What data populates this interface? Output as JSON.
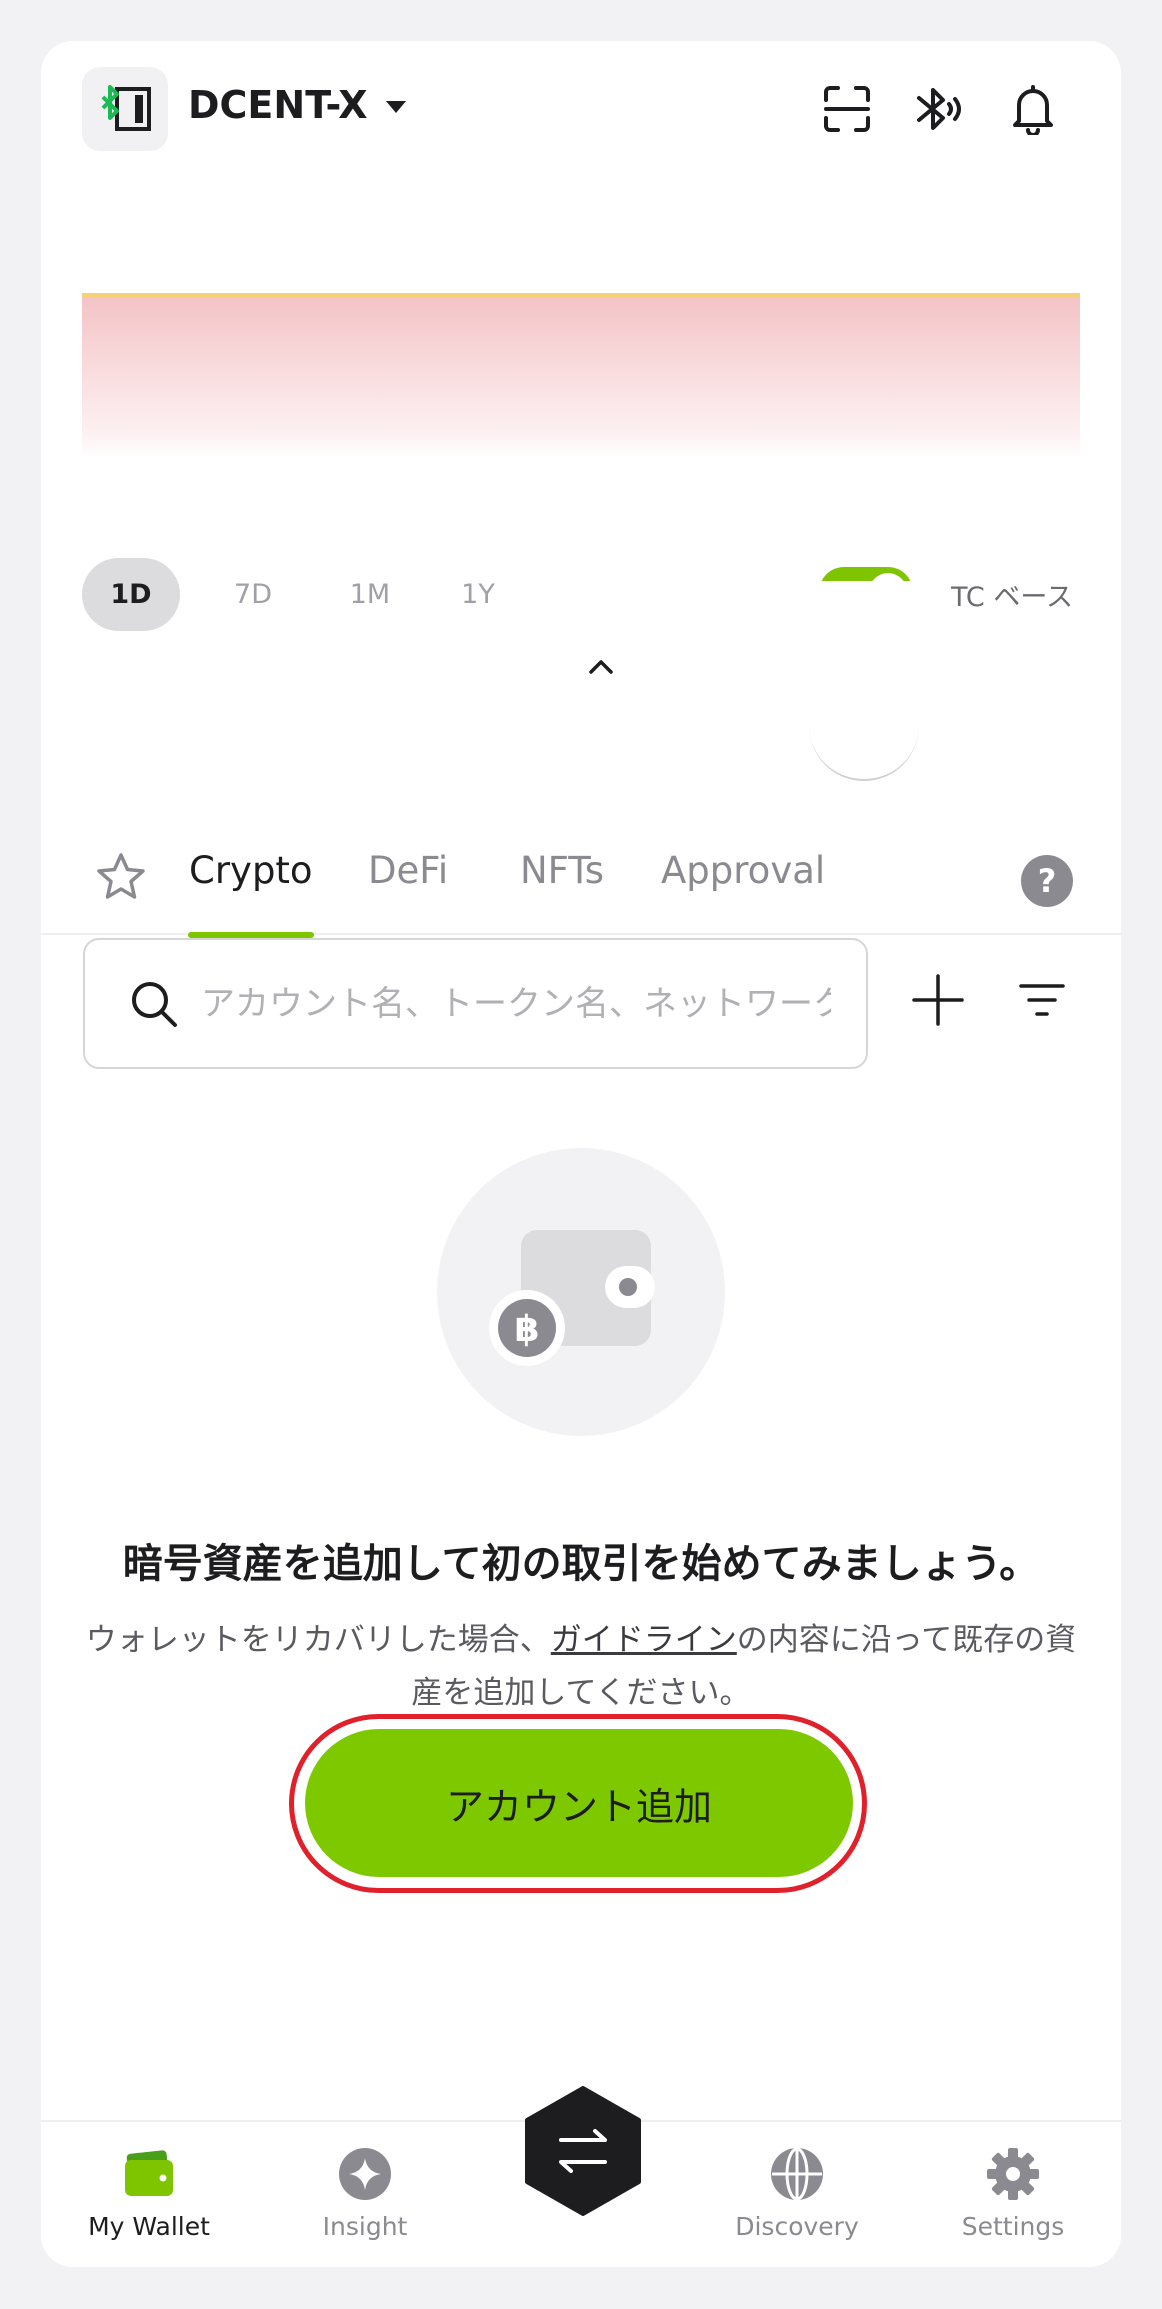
{
  "header": {
    "wallet_name": "DCENT-X",
    "icons": [
      "scan-icon",
      "bluetooth-icon",
      "bell-icon"
    ]
  },
  "chart": {
    "line_color": "#f3d278",
    "fill_color": "#f4c4c7"
  },
  "periods": {
    "items": [
      "1D",
      "7D",
      "1M",
      "1Y"
    ],
    "selected": "1D"
  },
  "base_toggle": {
    "label": "TC ベース",
    "color": "#7ec500"
  },
  "tabs": {
    "items": [
      "Crypto",
      "DeFi",
      "NFTs",
      "Approval"
    ],
    "active": "Crypto",
    "help": "?"
  },
  "search": {
    "placeholder": "アカウント名、トークン名、ネットワーク名",
    "value": ""
  },
  "empty_state": {
    "title": "暗号資産を追加して初の取引を始めてみましょう。",
    "desc_before": "ウォレットをリカバリした場合、",
    "desc_link": "ガイドライン",
    "desc_after": "の内容に沿って既存の資産を追加してください。",
    "button_label": "アカウント追加"
  },
  "bottom_nav": {
    "items": [
      "My Wallet",
      "Insight",
      "Discovery",
      "Settings"
    ],
    "active": "My Wallet"
  },
  "colors": {
    "accent": "#7ec500",
    "highlight_ring": "#e0202a"
  }
}
